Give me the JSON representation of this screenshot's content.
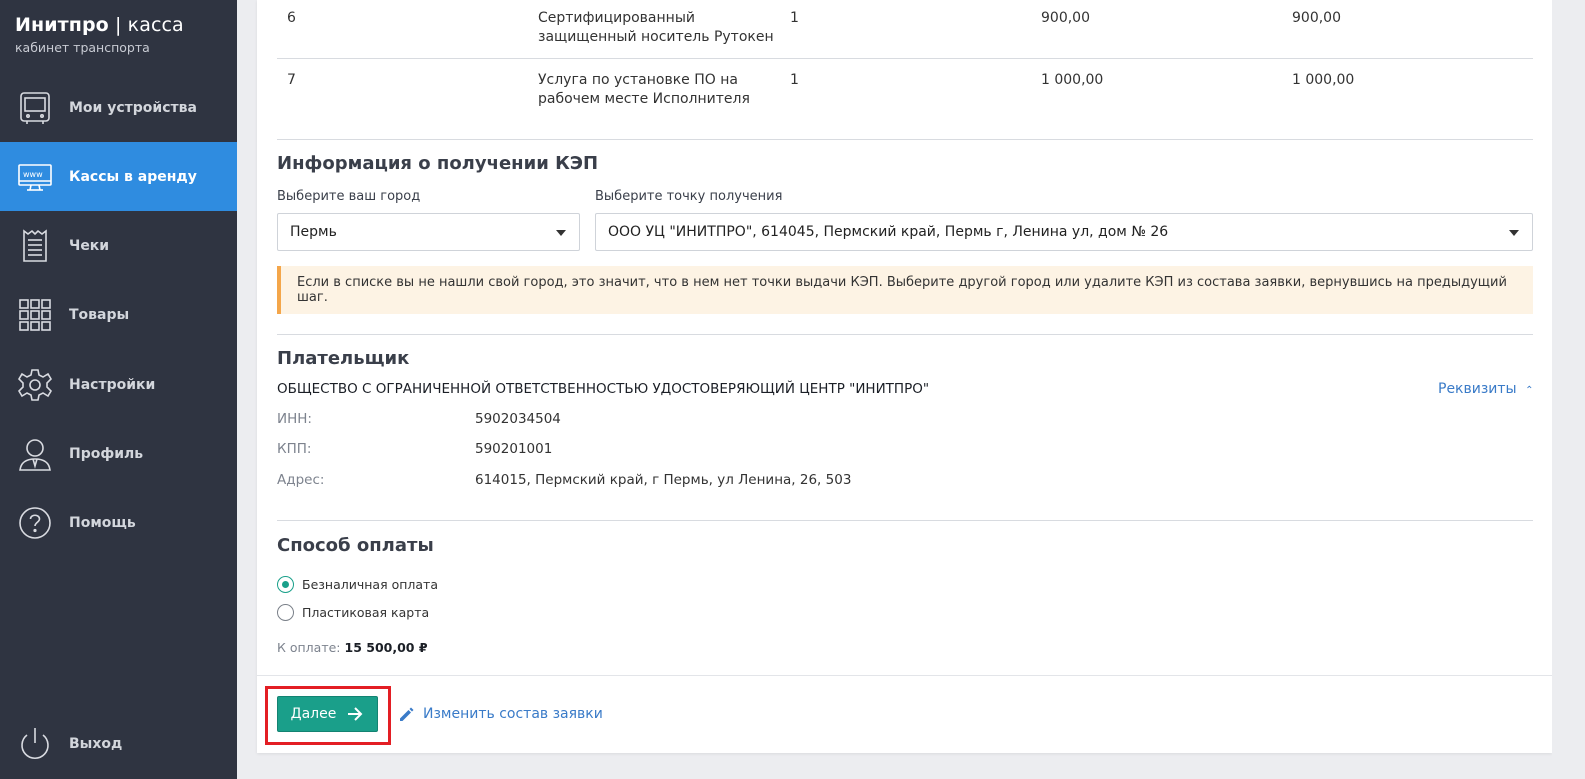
{
  "brand": {
    "title_bold": "Инитпро",
    "title_sep": " | ",
    "title_light": "касса",
    "subtitle": "кабинет транспорта"
  },
  "nav": {
    "items": [
      {
        "label": "Мои устройства",
        "icon": "device-icon"
      },
      {
        "label": "Кассы в аренду",
        "icon": "www-monitor-icon",
        "active": true
      },
      {
        "label": "Чеки",
        "icon": "receipt-icon"
      },
      {
        "label": "Товары",
        "icon": "grid-icon"
      },
      {
        "label": "Настройки",
        "icon": "gear-icon"
      },
      {
        "label": "Профиль",
        "icon": "user-icon"
      },
      {
        "label": "Помощь",
        "icon": "help-icon"
      }
    ],
    "logout": {
      "label": "Выход",
      "icon": "power-icon"
    }
  },
  "table": {
    "rows": [
      {
        "num": "6",
        "name_line1": "Сертифицированный",
        "name_line2": "защищенный носитель Рутокен",
        "qty": "1",
        "price": "900,00",
        "sum": "900,00"
      },
      {
        "num": "7",
        "name_line1": "Услуга по установке ПО на",
        "name_line2": "рабочем месте Исполнителя",
        "qty": "1",
        "price": "1 000,00",
        "sum": "1 000,00"
      }
    ]
  },
  "kep": {
    "title": "Информация о получении КЭП",
    "city_label": "Выберите ваш город",
    "city_value": "Пермь",
    "point_label": "Выберите точку получения",
    "point_value": "ООО УЦ \"ИНИТПРО\", 614045, Пермский край, Пермь г, Ленина ул, дом № 26",
    "notice": "Если в списке вы не нашли свой город, это значит, что в нем нет точки выдачи КЭП. Выберите другой город или удалите КЭП из состава заявки, вернувшись на предыдущий шаг.",
    "notice_color": "#f4a64a"
  },
  "payer": {
    "title": "Плательщик",
    "name": "ОБЩЕСТВО С ОГРАНИЧЕННОЙ ОТВЕТСТВЕННОСТЬЮ УДОСТОВЕРЯЮЩИЙ ЦЕНТР \"ИНИТПРО\"",
    "requisites_link": "Реквизиты",
    "inn_label": "ИНН:",
    "inn": "5902034504",
    "kpp_label": "КПП:",
    "kpp": "590201001",
    "address_label": "Адрес:",
    "address": "614015, Пермский край, г Пермь, ул Ленина, 26, 503"
  },
  "payment": {
    "title": "Способ оплаты",
    "options": [
      {
        "label": "Безналичная оплата",
        "checked": true
      },
      {
        "label": "Пластиковая карта",
        "checked": false
      }
    ],
    "total_label": "К оплате:",
    "total_value": "15 500,00 ₽"
  },
  "actions": {
    "next_label": "Далее",
    "edit_label": "Изменить состав заявки"
  },
  "colors": {
    "sidebar": "#2f3441",
    "active": "#2f8ce0",
    "primary": "#1a9f8a",
    "link": "#3a7bc8",
    "highlight": "#e31e24"
  }
}
